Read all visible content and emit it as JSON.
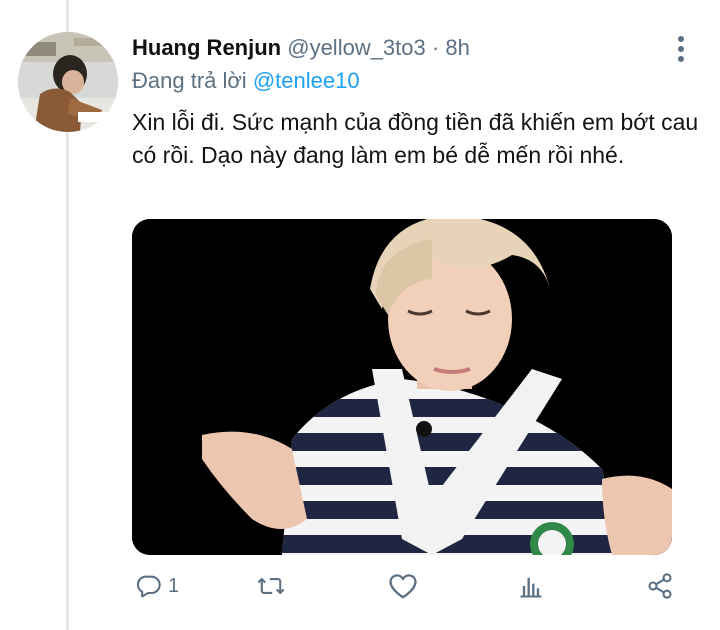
{
  "tweet": {
    "author": {
      "display_name": "Huang Renjun",
      "handle": "@yellow_3to3",
      "separator": "·",
      "time": "8h"
    },
    "reply": {
      "label": "Đang trả lời",
      "mention": "@tenlee10"
    },
    "text": "Xin lỗi đi. Sức mạnh của đồng tiền đã khiến em bớt cau có rồi. Dạo này đang làm em bé dễ mến rồi nhé.",
    "media": {
      "type": "photo"
    },
    "actions": {
      "reply_icon": "reply-bubble-icon",
      "reply_count": "1",
      "retweet_icon": "retweet-icon",
      "like_icon": "heart-icon",
      "analytics_icon": "analytics-bars-icon",
      "share_icon": "share-icon"
    }
  },
  "colors": {
    "accent": "#1da1f2",
    "secondary_text": "#5b7083",
    "text": "#0f1419",
    "thread_line": "#e6e6e6"
  }
}
